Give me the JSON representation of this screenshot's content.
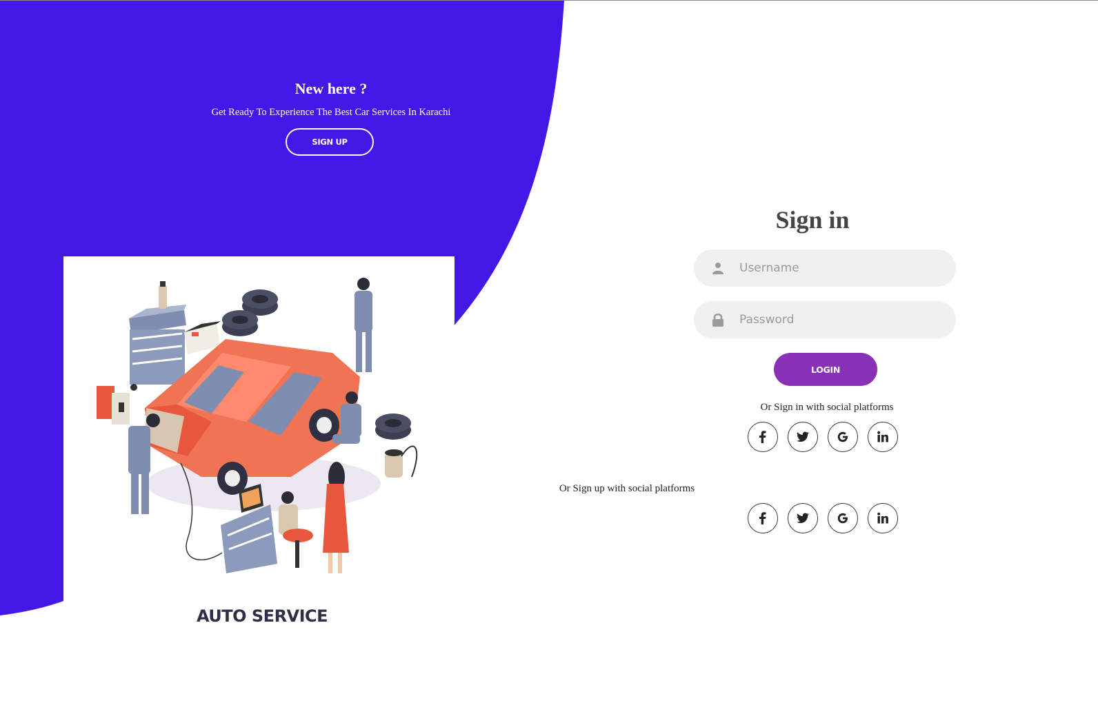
{
  "colors": {
    "brand_blue": "#4318e6",
    "login_purple": "#8931b8",
    "field_bg": "#f0f0f0"
  },
  "left_panel": {
    "title": "New here ?",
    "subtitle": "Get Ready To Experience The Best Car Services In Karachi",
    "signup_label": "SIGN UP",
    "brand_caption": "AUTO SERVICE"
  },
  "signin": {
    "title": "Sign in",
    "username_placeholder": "Username",
    "password_placeholder": "Password",
    "login_label": "LOGIN",
    "social_text": "Or Sign in with social platforms"
  },
  "signup": {
    "social_text": "Or Sign up with social platforms"
  },
  "social_icons": [
    "facebook-icon",
    "twitter-icon",
    "google-icon",
    "linkedin-icon"
  ]
}
